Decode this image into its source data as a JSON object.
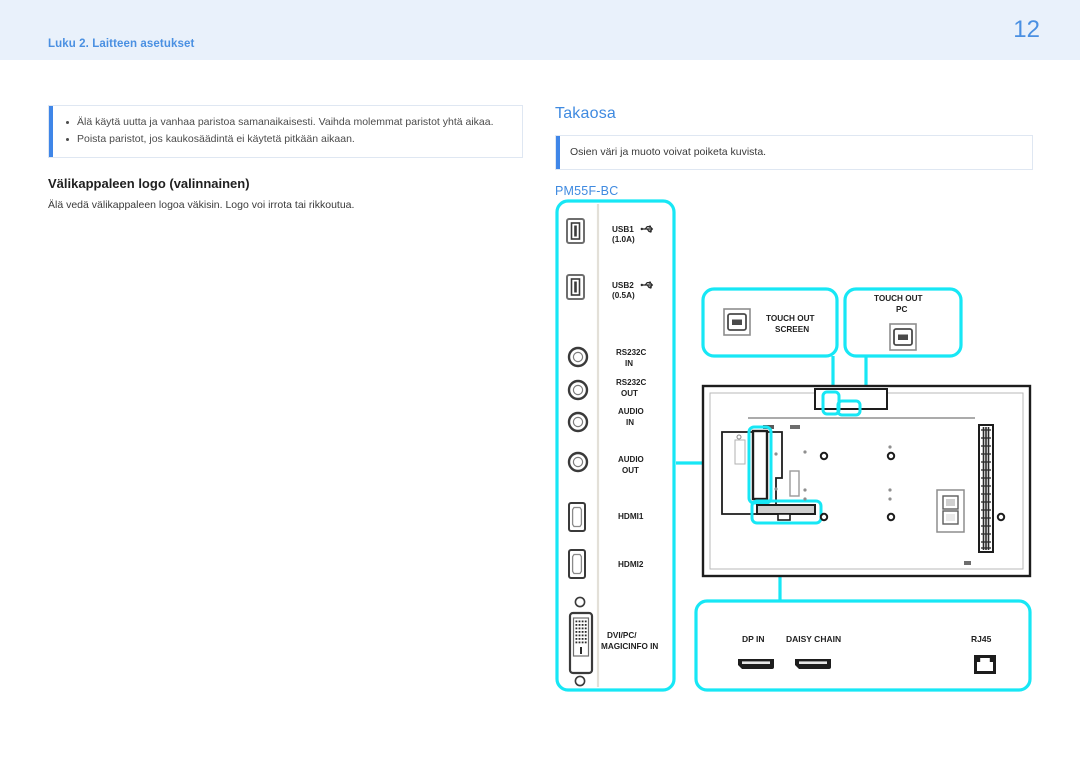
{
  "header": {
    "chapter_label": "Luku 2. Laitteen asetukset",
    "page_number": "12",
    "band_color": "#e9f1fb",
    "accent_color": "#3f8ae0"
  },
  "left_column": {
    "note": {
      "bullets": [
        "Älä käytä uutta ja vanhaa paristoa samanaikaisesti. Vaihda molemmat paristot yhtä aikaa.",
        "Poista paristot, jos kaukosäädintä ei käytetä pitkään aikaan."
      ],
      "bar_color": "#3f86e8"
    },
    "subheading": "Välikappaleen logo (valinnainen)",
    "body_text": "Älä vedä välikappaleen logoa väkisin. Logo voi irrota tai rikkoutua."
  },
  "right_column": {
    "section_title": "Takaosa",
    "note_text": "Osien väri ja muoto voivat poiketa kuvista.",
    "model_name": "PM55F-BC"
  },
  "diagram": {
    "highlight_color": "#17e7f5",
    "port_panel": {
      "label": "port-panel",
      "ports": [
        {
          "id": "usb1",
          "line1": "USB1",
          "line2": "(1.0A)",
          "symbol": "usb-trident",
          "icon": "usb-a-port"
        },
        {
          "id": "usb2",
          "line1": "USB2",
          "line2": "(0.5A)",
          "symbol": "usb-trident",
          "icon": "usb-a-port"
        },
        {
          "id": "rs232in",
          "line1": "RS232C",
          "line2": "IN",
          "symbol": "",
          "icon": "stereo-jack"
        },
        {
          "id": "rs232out",
          "line1": "RS232C",
          "line2": "OUT",
          "symbol": "",
          "icon": "stereo-jack"
        },
        {
          "id": "audioin",
          "line1": "AUDIO",
          "line2": "IN",
          "symbol": "",
          "icon": "stereo-jack"
        },
        {
          "id": "audioout",
          "line1": "AUDIO",
          "line2": "OUT",
          "symbol": "",
          "icon": "stereo-jack"
        },
        {
          "id": "hdmi1",
          "line1": "HDMI1",
          "line2": "",
          "symbol": "",
          "icon": "hdmi-port"
        },
        {
          "id": "hdmi2",
          "line1": "HDMI2",
          "line2": "",
          "symbol": "",
          "icon": "hdmi-port"
        },
        {
          "id": "dvi",
          "line1": "DVI/PC/",
          "line2": "MAGICINFO IN",
          "symbol": "",
          "icon": "dvi-port"
        }
      ]
    },
    "touch_out_screen": {
      "line1": "TOUCH OUT",
      "line2": "SCREEN",
      "icon": "usb-b-port"
    },
    "touch_out_pc": {
      "line1": "TOUCH OUT",
      "line2": "PC",
      "icon": "usb-b-port"
    },
    "bottom_panel": {
      "items": [
        {
          "id": "dp-in",
          "label": "DP IN",
          "icon": "displayport-connector"
        },
        {
          "id": "daisy-chain",
          "label": "DAISY CHAIN",
          "icon": "displayport-connector"
        },
        {
          "id": "rj45",
          "label": "RJ45",
          "icon": "rj45-jack"
        }
      ]
    },
    "display_back": {
      "label": "display-rear-view"
    }
  }
}
